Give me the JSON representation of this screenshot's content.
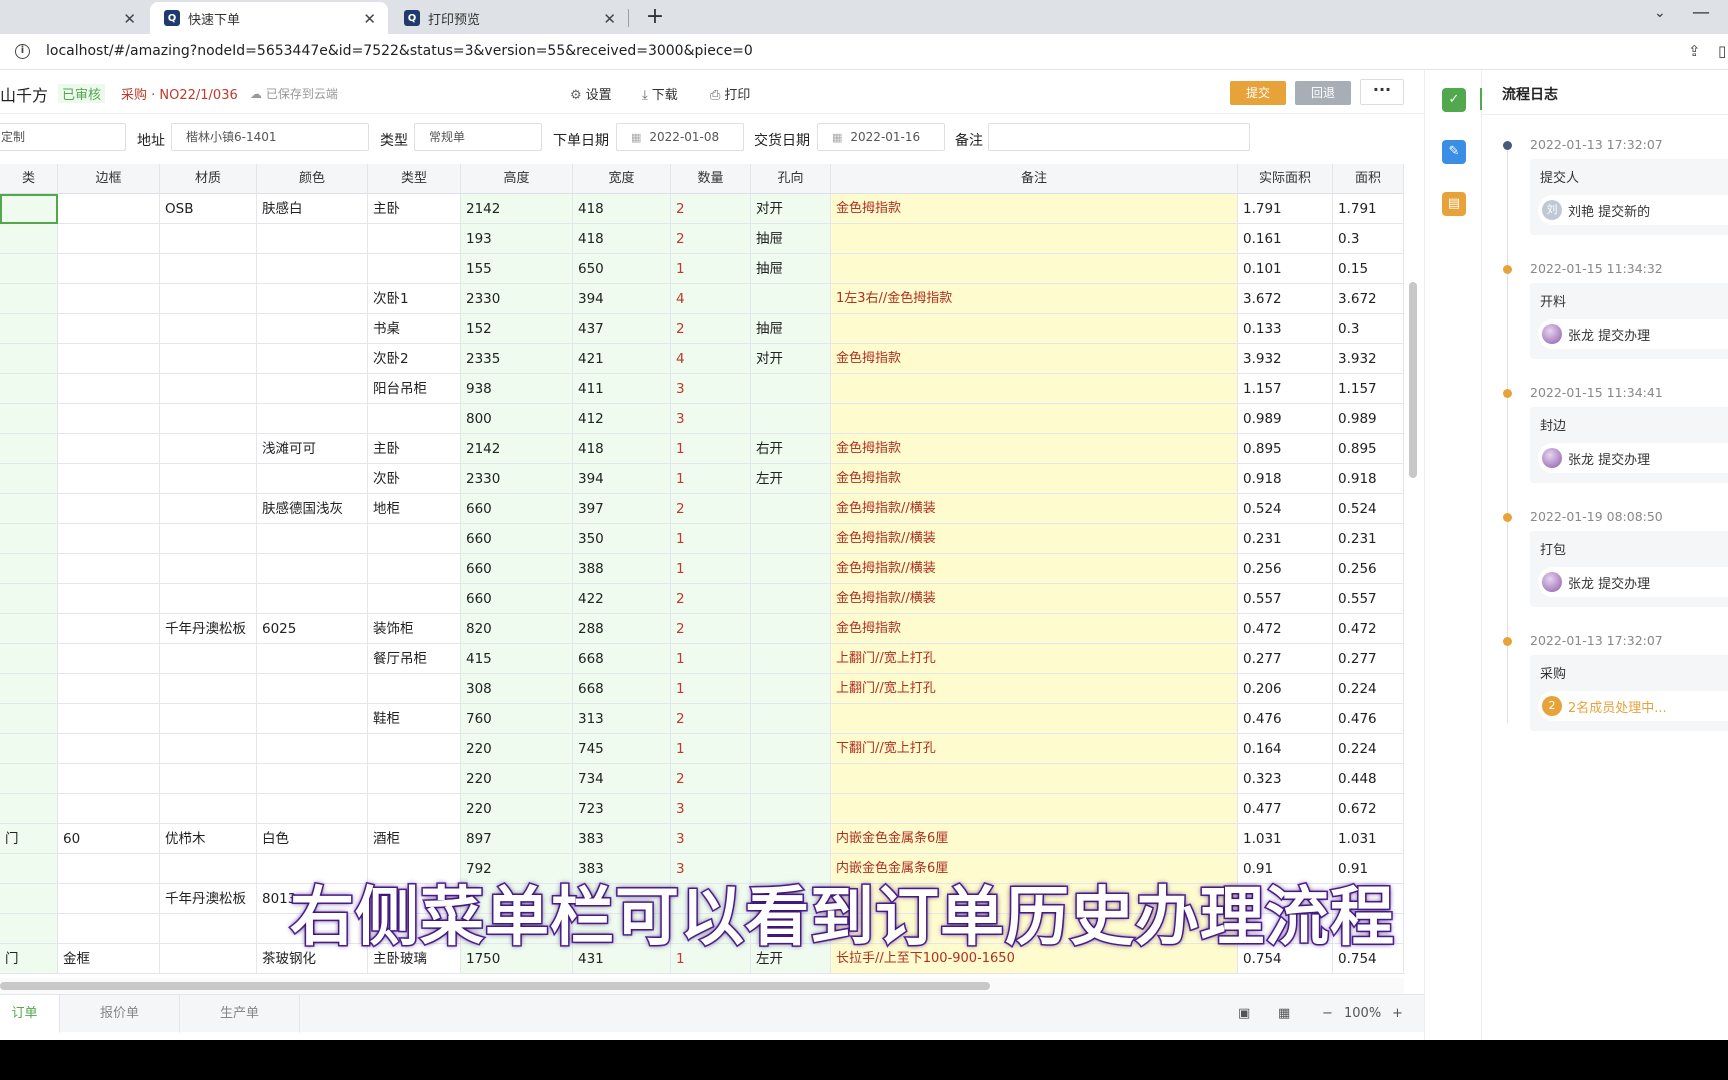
{
  "browser": {
    "tabs": [
      {
        "title": "",
        "favicon": ""
      },
      {
        "title": "快速下单",
        "favicon": "Q"
      },
      {
        "title": "打印预览",
        "favicon": "Q"
      }
    ],
    "url": "localhost/#/amazing?nodeId=5653447e&id=7522&status=3&version=55&received=3000&piece=0"
  },
  "toolbar": {
    "order_name": "山千方",
    "status": "已审核",
    "purchase": "采购 · NO22/1/036",
    "cloud": "已保存到云端",
    "settings": "设置",
    "download": "下载",
    "print": "打印",
    "submit": "提交",
    "return": "回退",
    "more": "···"
  },
  "form": {
    "type_left_value": "定制",
    "address_label": "地址",
    "address_value": "楷林小镇6-1401",
    "type_label": "类型",
    "type_value": "常规单",
    "order_date_label": "下单日期",
    "order_date_value": "2022-01-08",
    "delivery_date_label": "交货日期",
    "delivery_date_value": "2022-01-16",
    "remark_label": "备注",
    "remark_value": ""
  },
  "grid": {
    "headers": [
      "类",
      "边框",
      "材质",
      "颜色",
      "类型",
      "高度",
      "宽度",
      "数量",
      "孔向",
      "备注",
      "实际面积",
      "面积"
    ],
    "rows": [
      [
        "",
        "",
        "OSB",
        "肤感白",
        "主卧",
        "2142",
        "418",
        "2",
        "对开",
        "金色拇指款",
        "1.791",
        "1.791"
      ],
      [
        "",
        "",
        "",
        "",
        "",
        "193",
        "418",
        "2",
        "抽屉",
        "",
        "0.161",
        "0.3"
      ],
      [
        "",
        "",
        "",
        "",
        "",
        "155",
        "650",
        "1",
        "抽屉",
        "",
        "0.101",
        "0.15"
      ],
      [
        "",
        "",
        "",
        "",
        "次卧1",
        "2330",
        "394",
        "4",
        "",
        "1左3右//金色拇指款",
        "3.672",
        "3.672"
      ],
      [
        "",
        "",
        "",
        "",
        "书桌",
        "152",
        "437",
        "2",
        "抽屉",
        "",
        "0.133",
        "0.3"
      ],
      [
        "",
        "",
        "",
        "",
        "次卧2",
        "2335",
        "421",
        "4",
        "对开",
        "金色拇指款",
        "3.932",
        "3.932"
      ],
      [
        "",
        "",
        "",
        "",
        "阳台吊柜",
        "938",
        "411",
        "3",
        "",
        "",
        "1.157",
        "1.157"
      ],
      [
        "",
        "",
        "",
        "",
        "",
        "800",
        "412",
        "3",
        "",
        "",
        "0.989",
        "0.989"
      ],
      [
        "",
        "",
        "",
        "浅滩可可",
        "主卧",
        "2142",
        "418",
        "1",
        "右开",
        "金色拇指款",
        "0.895",
        "0.895"
      ],
      [
        "",
        "",
        "",
        "",
        "次卧",
        "2330",
        "394",
        "1",
        "左开",
        "金色拇指款",
        "0.918",
        "0.918"
      ],
      [
        "",
        "",
        "",
        "肤感德国浅灰",
        "地柜",
        "660",
        "397",
        "2",
        "",
        "金色拇指款//横装",
        "0.524",
        "0.524"
      ],
      [
        "",
        "",
        "",
        "",
        "",
        "660",
        "350",
        "1",
        "",
        "金色拇指款//横装",
        "0.231",
        "0.231"
      ],
      [
        "",
        "",
        "",
        "",
        "",
        "660",
        "388",
        "1",
        "",
        "金色拇指款//横装",
        "0.256",
        "0.256"
      ],
      [
        "",
        "",
        "",
        "",
        "",
        "660",
        "422",
        "2",
        "",
        "金色拇指款//横装",
        "0.557",
        "0.557"
      ],
      [
        "",
        "",
        "千年丹澳松板",
        "6025",
        "装饰柜",
        "820",
        "288",
        "2",
        "",
        "金色拇指款",
        "0.472",
        "0.472"
      ],
      [
        "",
        "",
        "",
        "",
        "餐厅吊柜",
        "415",
        "668",
        "1",
        "",
        "上翻门//宽上打孔",
        "0.277",
        "0.277"
      ],
      [
        "",
        "",
        "",
        "",
        "",
        "308",
        "668",
        "1",
        "",
        "上翻门//宽上打孔",
        "0.206",
        "0.224"
      ],
      [
        "",
        "",
        "",
        "",
        "鞋柜",
        "760",
        "313",
        "2",
        "",
        "",
        "0.476",
        "0.476"
      ],
      [
        "",
        "",
        "",
        "",
        "",
        "220",
        "745",
        "1",
        "",
        "下翻门//宽上打孔",
        "0.164",
        "0.224"
      ],
      [
        "",
        "",
        "",
        "",
        "",
        "220",
        "734",
        "2",
        "",
        "",
        "0.323",
        "0.448"
      ],
      [
        "",
        "",
        "",
        "",
        "",
        "220",
        "723",
        "3",
        "",
        "",
        "0.477",
        "0.672"
      ],
      [
        "门",
        "60",
        "优栉木",
        "白色",
        "酒柜",
        "897",
        "383",
        "3",
        "",
        "内嵌金色金属条6厘",
        "1.031",
        "1.031"
      ],
      [
        "",
        "",
        "",
        "",
        "",
        "792",
        "383",
        "3",
        "",
        "内嵌金色金属条6厘",
        "0.91",
        "0.91"
      ],
      [
        "",
        "",
        "千年丹澳松板",
        "8013",
        "",
        "",
        "",
        "",
        "",
        "",
        "",
        ""
      ],
      [
        "",
        "",
        "",
        "",
        "",
        "",
        "",
        "",
        "",
        "",
        "",
        ""
      ],
      [
        "门",
        "金框",
        "",
        "茶玻钢化",
        "主卧玻璃",
        "1750",
        "431",
        "1",
        "左开",
        "长拉手//上至下100-900-1650",
        "0.754",
        "0.754"
      ]
    ]
  },
  "sheets": [
    "订单",
    "报价单",
    "生产单"
  ],
  "statusbar": {
    "zoom": "100%",
    "minus": "−",
    "plus": "+"
  },
  "log": {
    "title": "流程日志",
    "entries": [
      {
        "time": "2022-01-13 17:32:07",
        "step": "提交人",
        "avatar": "刘",
        "user": "刘艳 提交新的",
        "color": "#4a5a7a"
      },
      {
        "time": "2022-01-15 11:34:32",
        "step": "开料",
        "avatar": "",
        "user": "张龙 提交办理",
        "color": "#e8a23a"
      },
      {
        "time": "2022-01-15 11:34:41",
        "step": "封边",
        "avatar": "",
        "user": "张龙 提交办理",
        "color": "#e8a23a"
      },
      {
        "time": "2022-01-19 08:08:50",
        "step": "打包",
        "avatar": "",
        "user": "张龙 提交办理",
        "color": "#e8a23a"
      },
      {
        "time": "2022-01-13 17:32:07",
        "step": "采购",
        "avatar": "2",
        "user": "2名成员处理中...",
        "color": "#e8a23a"
      }
    ]
  },
  "subtitle": "右侧菜单栏可以看到订单历史办理流程"
}
